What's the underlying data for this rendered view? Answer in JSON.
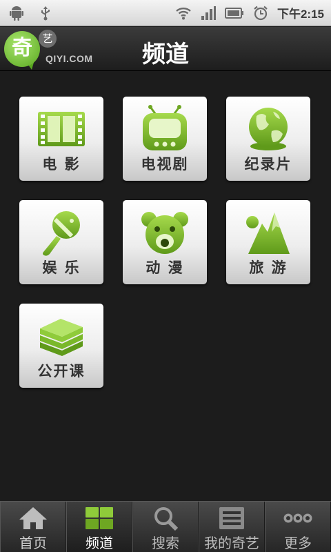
{
  "status_bar": {
    "left_icons": [
      "android-debug-icon",
      "usb-icon"
    ],
    "right_icons": [
      "wifi-icon",
      "signal-icon",
      "battery-icon",
      "alarm-icon"
    ],
    "time": "下午2:15"
  },
  "header": {
    "logo_char": "奇",
    "logo_small_char": "艺",
    "logo_text": "QIYI.COM",
    "title": "频道"
  },
  "channels": [
    {
      "label": "电 影",
      "icon": "film-icon"
    },
    {
      "label": "电视剧",
      "icon": "tv-icon"
    },
    {
      "label": "纪录片",
      "icon": "globe-icon"
    },
    {
      "label": "娱 乐",
      "icon": "microphone-icon"
    },
    {
      "label": "动 漫",
      "icon": "bear-icon"
    },
    {
      "label": "旅 游",
      "icon": "mountain-icon"
    },
    {
      "label": "公开课",
      "icon": "books-icon"
    }
  ],
  "bottom_nav": [
    {
      "label": "首页",
      "icon": "home-icon",
      "active": false
    },
    {
      "label": "频道",
      "icon": "grid-icon",
      "active": true
    },
    {
      "label": "搜索",
      "icon": "search-icon",
      "active": false
    },
    {
      "label": "我的奇艺",
      "icon": "list-icon",
      "active": false
    },
    {
      "label": "更多",
      "icon": "more-icon",
      "active": false
    }
  ],
  "colors": {
    "accent_green": "#7ab82a",
    "background": "#1c1c1c",
    "tile_label": "#333333"
  }
}
